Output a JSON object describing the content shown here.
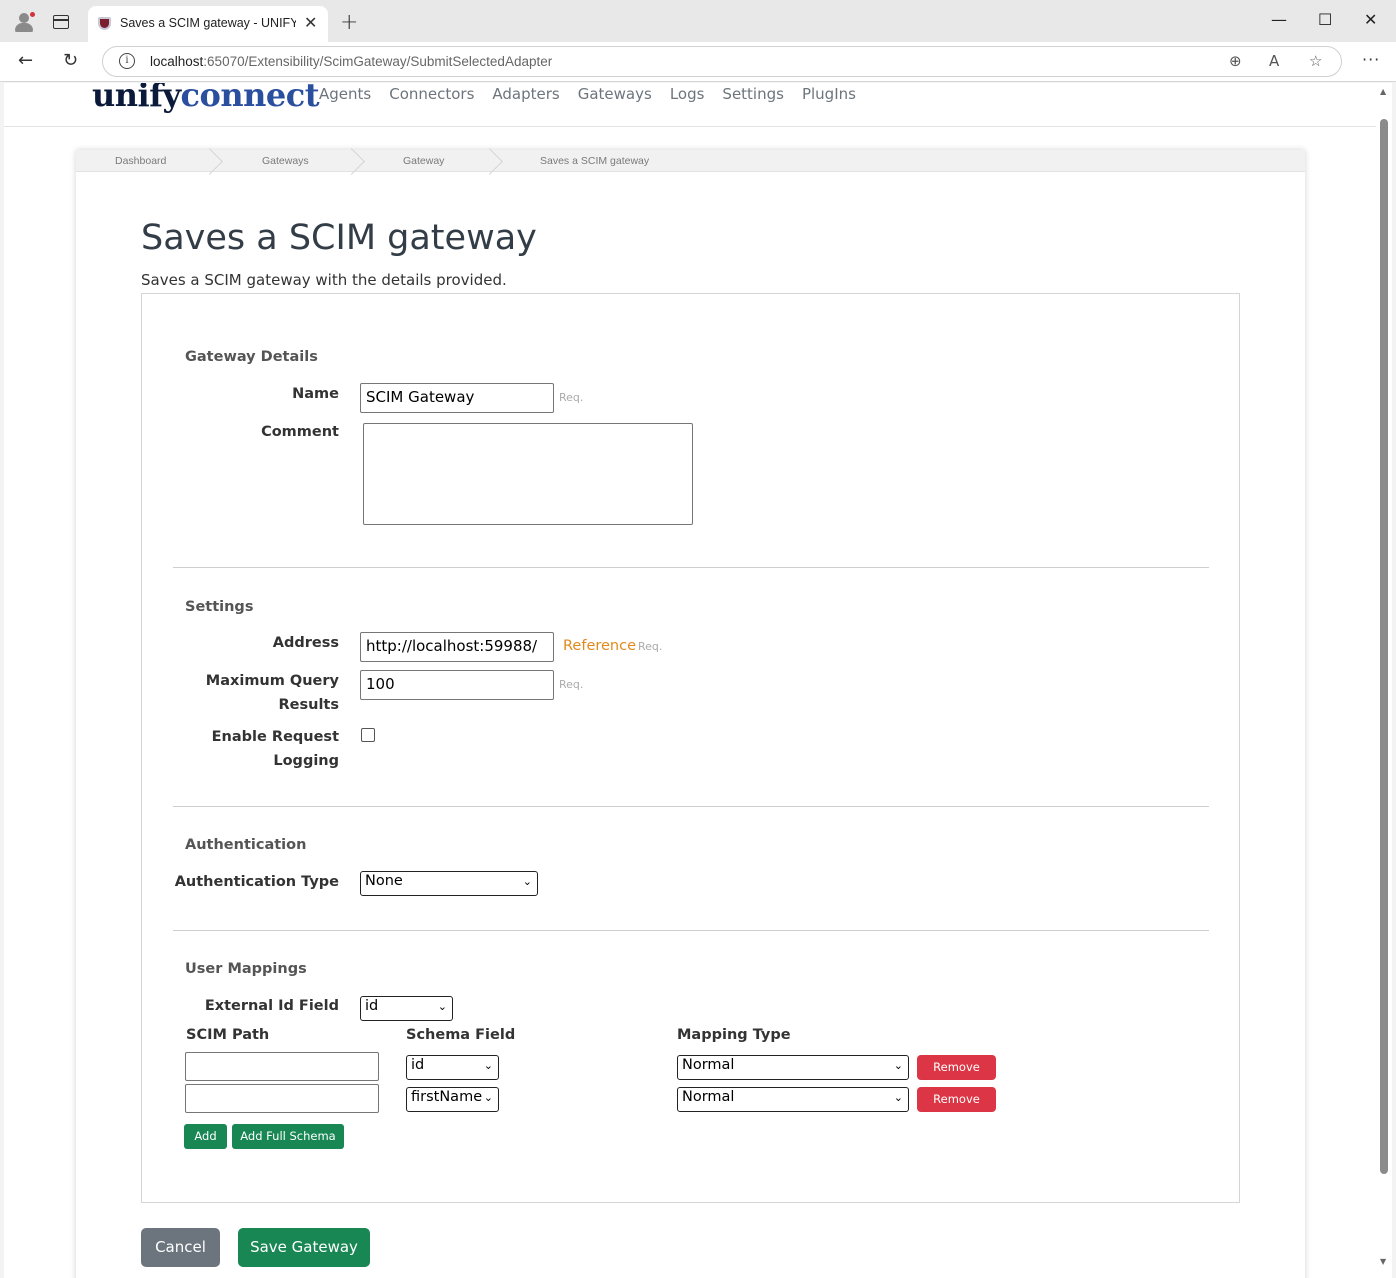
{
  "browser": {
    "tab_title": "Saves a SCIM gateway - UNIFYConnect",
    "url_host": "localhost",
    "url_rest": ":65070/Extensibility/ScimGateway/SubmitSelectedAdapter",
    "icons": [
      "profile-icon",
      "tab-actions-icon",
      "back-icon",
      "refresh-icon",
      "zoom-icon",
      "read-aloud-icon",
      "favorite-icon",
      "more-icon"
    ]
  },
  "site": {
    "logo_main": "unify",
    "logo_accent": "connect",
    "nav": [
      "Agents",
      "Connectors",
      "Adapters",
      "Gateways",
      "Logs",
      "Settings",
      "PlugIns"
    ]
  },
  "breadcrumb": [
    "Dashboard",
    "Gateways",
    "Gateway",
    "Saves a SCIM gateway"
  ],
  "page": {
    "title": "Saves a SCIM gateway",
    "subtitle": "Saves a SCIM gateway with the details provided."
  },
  "gateway_details": {
    "section": "Gateway Details",
    "name_label": "Name",
    "name_value": "SCIM Gateway",
    "comment_label": "Comment",
    "comment_value": "",
    "req": "Req."
  },
  "settings": {
    "section": "Settings",
    "address_label": "Address",
    "address_value": "http://localhost:59988/",
    "reference": "Reference",
    "max_label_1": "Maximum Query",
    "max_label_2": "Results",
    "max_value": "100",
    "logging_label_1": "Enable Request",
    "logging_label_2": "Logging",
    "logging_checked": false,
    "req": "Req."
  },
  "authentication": {
    "section": "Authentication",
    "type_label": "Authentication Type",
    "type_value": "None"
  },
  "user_mappings": {
    "section": "User Mappings",
    "external_label": "External Id Field",
    "external_value": "id",
    "col_scim_path": "SCIM Path",
    "col_schema_field": "Schema Field",
    "col_mapping_type": "Mapping Type",
    "rows": [
      {
        "scim_path": "",
        "schema_field": "id",
        "mapping_type": "Normal",
        "remove": "Remove"
      },
      {
        "scim_path": "",
        "schema_field": "firstName",
        "mapping_type": "Normal",
        "remove": "Remove"
      }
    ],
    "add": "Add",
    "add_full": "Add Full Schema"
  },
  "actions": {
    "cancel": "Cancel",
    "save": "Save Gateway"
  },
  "colors": {
    "primary_green": "#198754",
    "danger_red": "#dc3545",
    "secondary_gray": "#6c757d",
    "reference_orange": "#e08a1e"
  }
}
